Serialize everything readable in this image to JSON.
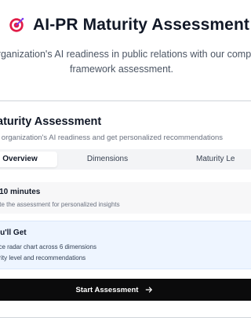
{
  "hero": {
    "title": "AI-PR Maturity Assessment",
    "subtitle_line1": "organization's AI readiness in public relations with our comp",
    "subtitle_line2": "framework assessment.",
    "icon": "target-icon"
  },
  "card": {
    "title": "aturity Assessment",
    "description": "r organization's AI readiness and get personalized recommendations",
    "tabs": [
      {
        "label": "Overview",
        "active": true
      },
      {
        "label": "Dimensions",
        "active": false
      },
      {
        "label": "Maturity Le",
        "active": false
      }
    ],
    "time_box": {
      "title": "t 10 minutes",
      "description": "lete the assessment for personalized insights"
    },
    "what_you_get": {
      "title": "ou'll Get",
      "items": [
        "nce radar chart across 6 dimensions",
        "urity level and recommendations"
      ]
    },
    "start_button": {
      "label": "Start Assessment",
      "icon": "arrow-right-icon"
    }
  },
  "colors": {
    "accent_target_red": "#e11d48",
    "accent_target_purple": "#7c3aed",
    "button_bg": "#0b0b0c",
    "info_bg": "#eef5ff",
    "muted_bg": "#f7f7f8"
  }
}
